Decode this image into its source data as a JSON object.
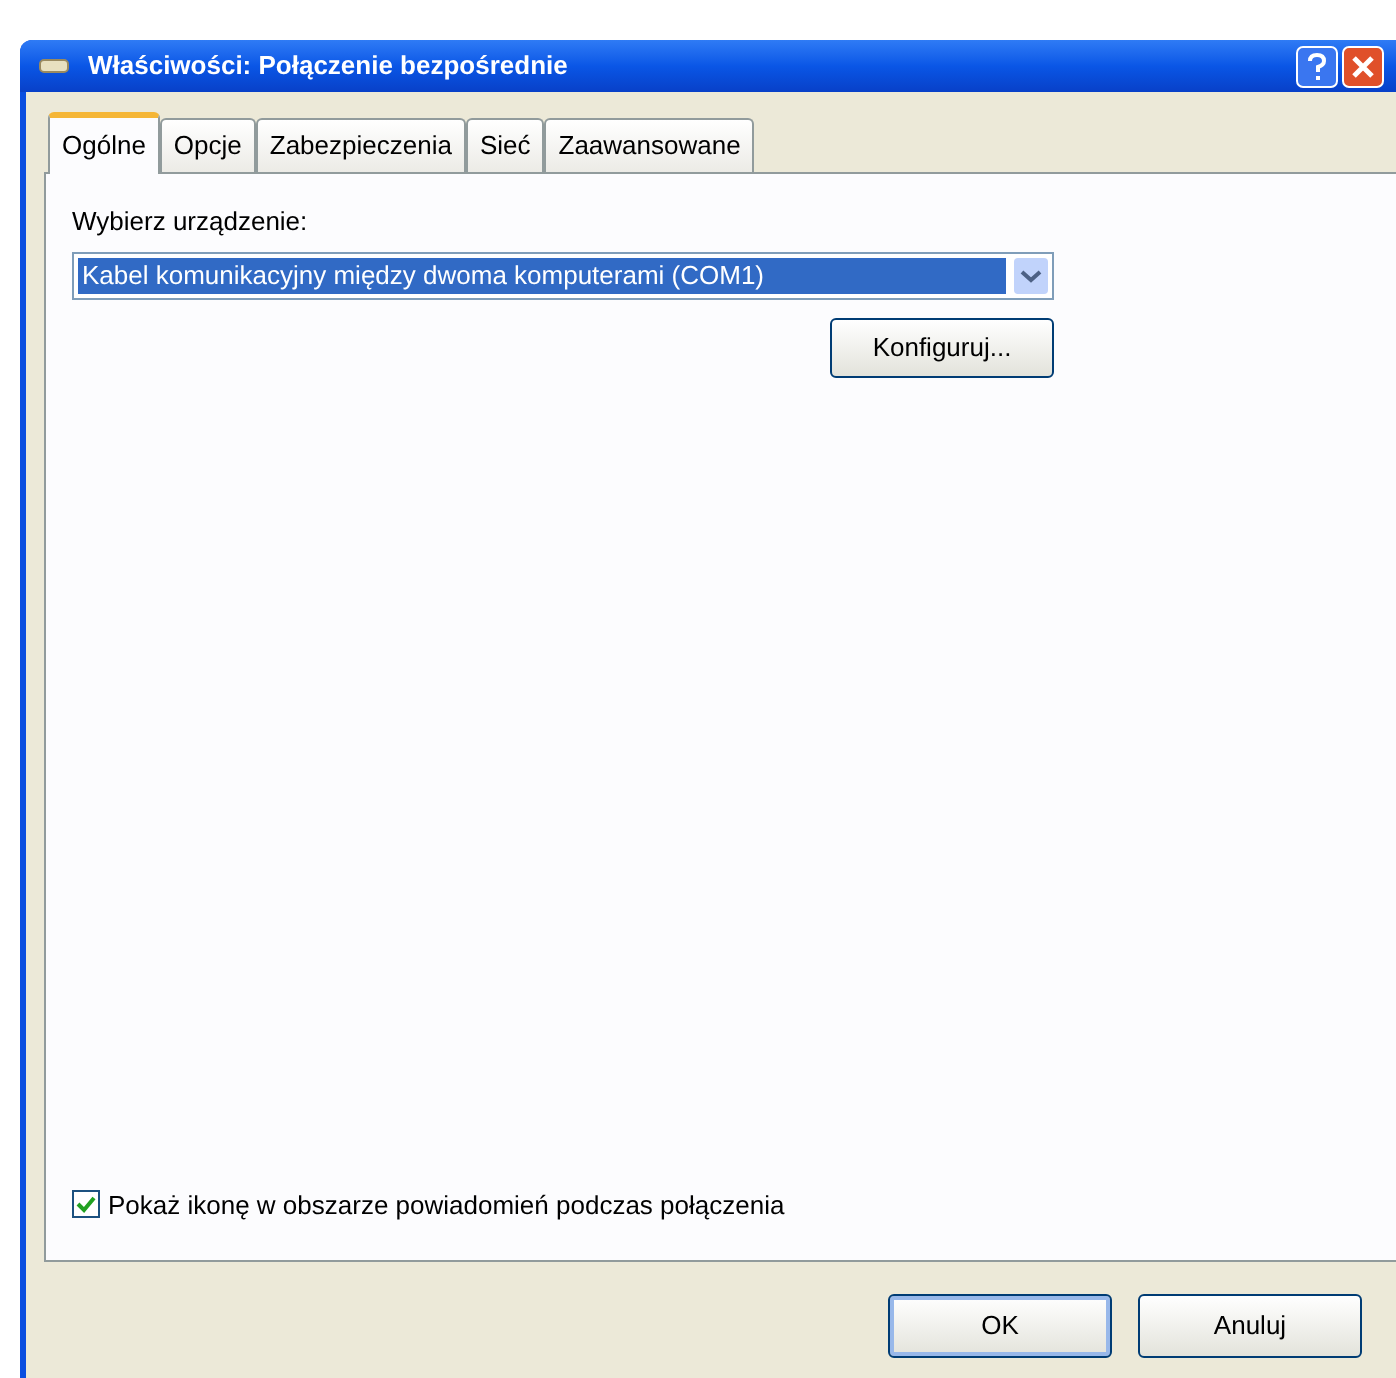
{
  "window": {
    "title": "Właściwości: Połączenie bezpośrednie"
  },
  "tabs": [
    {
      "label": "Ogólne",
      "selected": true
    },
    {
      "label": "Opcje",
      "selected": false
    },
    {
      "label": "Zabezpieczenia",
      "selected": false
    },
    {
      "label": "Sieć",
      "selected": false
    },
    {
      "label": "Zaawansowane",
      "selected": false
    }
  ],
  "device": {
    "label": "Wybierz urządzenie:",
    "value": "Kabel komunikacyjny między dwoma komputerami (COM1)",
    "configure_button": "Konfiguruj..."
  },
  "notify_checkbox": {
    "label": "Pokaż ikonę w obszarze powiadomień podczas połączenia",
    "checked": true
  },
  "buttons": [
    "OK",
    "Anuluj"
  ]
}
